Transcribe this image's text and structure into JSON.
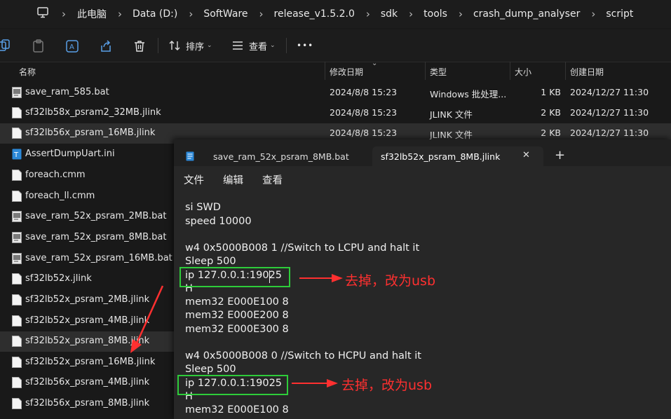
{
  "address_bar": {
    "crumbs": [
      "此电脑",
      "Data (D:)",
      "SoftWare",
      "release_v1.5.2.0",
      "sdk",
      "tools",
      "crash_dump_analyser",
      "script"
    ]
  },
  "toolbar": {
    "sort_label": "排序",
    "view_label": "查看",
    "more_label": "•••"
  },
  "columns": {
    "name": "名称",
    "modified": "修改日期",
    "type": "类型",
    "size": "大小",
    "created": "创建日期"
  },
  "files": [
    {
      "name": "save_ram_585.bat",
      "modified": "2024/8/8 15:23",
      "type": "Windows 批处理...",
      "size": "1 KB",
      "created": "2024/12/27 11:30",
      "icon": "bat-file-icon"
    },
    {
      "name": "sf32lb58x_psram2_32MB.jlink",
      "modified": "2024/8/8 15:23",
      "type": "JLINK 文件",
      "size": "2 KB",
      "created": "2024/12/27 11:30",
      "icon": "file-icon"
    },
    {
      "name": "sf32lb56x_psram_16MB.jlink",
      "modified": "2024/8/8 15:23",
      "type": "JLINK 文件",
      "size": "2 KB",
      "created": "2024/12/27 11:30",
      "icon": "file-icon"
    },
    {
      "name": "AssertDumpUart.ini",
      "icon": "ini-file-icon"
    },
    {
      "name": "foreach.cmm",
      "icon": "file-icon"
    },
    {
      "name": "foreach_ll.cmm",
      "icon": "file-icon"
    },
    {
      "name": "save_ram_52x_psram_2MB.bat",
      "icon": "bat-file-icon"
    },
    {
      "name": "save_ram_52x_psram_8MB.bat",
      "icon": "bat-file-icon"
    },
    {
      "name": "save_ram_52x_psram_16MB.bat",
      "icon": "bat-file-icon"
    },
    {
      "name": "sf32lb52x.jlink",
      "icon": "file-icon"
    },
    {
      "name": "sf32lb52x_psram_2MB.jlink",
      "icon": "file-icon"
    },
    {
      "name": "sf32lb52x_psram_4MB.jlink",
      "icon": "file-icon"
    },
    {
      "name": "sf32lb52x_psram_8MB.jlink",
      "icon": "file-icon"
    },
    {
      "name": "sf32lb52x_psram_16MB.jlink",
      "icon": "file-icon"
    },
    {
      "name": "sf32lb56x_psram_4MB.jlink",
      "icon": "file-icon"
    },
    {
      "name": "sf32lb56x_psram_8MB.jlink",
      "icon": "file-icon"
    }
  ],
  "notepad": {
    "tabs": [
      {
        "title": "save_ram_52x_psram_8MB.bat"
      },
      {
        "title": "sf32lb52x_psram_8MB.jlink"
      }
    ],
    "close_label": "✕",
    "new_tab_label": "+",
    "menu": [
      "文件",
      "编辑",
      "查看"
    ],
    "lines": [
      "si SWD",
      "speed 10000",
      "",
      "w4 0x5000B008 1 //Switch to LCPU and halt it",
      "Sleep 500",
      "ip 127.0.0.1:19025",
      "H",
      "mem32 E000E100 8",
      "mem32 E000E200 8",
      "mem32 E000E300 8",
      "",
      "w4 0x5000B008 0 //Switch to HCPU and halt it",
      "Sleep 500",
      "ip 127.0.0.1:19025",
      "H",
      "mem32 E000E100 8"
    ]
  },
  "annotations": {
    "first": "去掉，改为usb",
    "second": "去掉，改为usb",
    "color": "#ff3030",
    "box_color": "#2ecc3a"
  }
}
